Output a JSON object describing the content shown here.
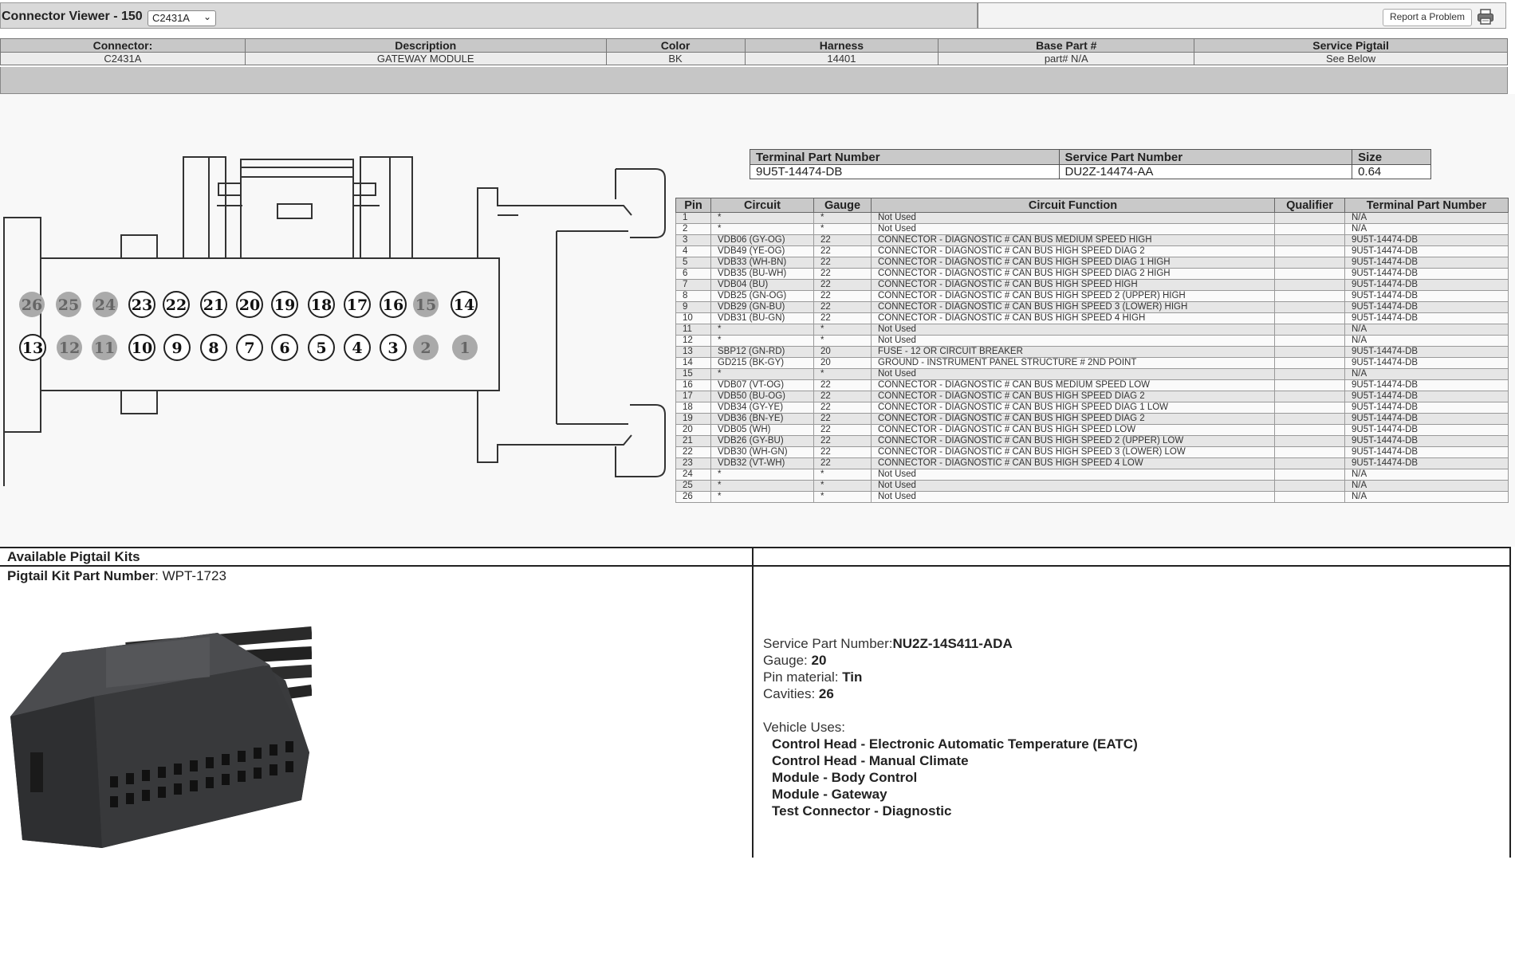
{
  "app": {
    "title": "Connector Viewer - 150",
    "selected_connector": "C2431A",
    "report_button": "Report a Problem"
  },
  "connector_header": {
    "columns": [
      "Connector:",
      "Description",
      "Color",
      "Harness",
      "Base Part #",
      "Service Pigtail"
    ],
    "values": [
      "C2431A",
      "GATEWAY MODULE",
      "BK",
      "14401",
      "part# N/A",
      "See Below"
    ]
  },
  "diagram": {
    "top_row": [
      "26",
      "25",
      "24",
      "23",
      "22",
      "21",
      "20",
      "19",
      "18",
      "17",
      "16",
      "15",
      "14"
    ],
    "bottom_row": [
      "13",
      "12",
      "11",
      "10",
      "9",
      "8",
      "7",
      "6",
      "5",
      "4",
      "3",
      "2",
      "1"
    ],
    "unused_pins": [
      "26",
      "25",
      "24",
      "15",
      "12",
      "11",
      "2",
      "1"
    ]
  },
  "terminal": {
    "headers": [
      "Terminal Part Number",
      "Service Part Number",
      "Size"
    ],
    "values": [
      "9U5T-14474-DB",
      "DU2Z-14474-AA",
      "0.64"
    ]
  },
  "pins": {
    "headers": [
      "Pin",
      "Circuit",
      "Gauge",
      "Circuit Function",
      "Qualifier",
      "Terminal Part Number"
    ],
    "rows": [
      [
        "1",
        "*",
        "*",
        "Not Used",
        "",
        "N/A"
      ],
      [
        "2",
        "*",
        "*",
        "Not Used",
        "",
        "N/A"
      ],
      [
        "3",
        "VDB06 (GY-OG)",
        "22",
        "CONNECTOR - DIAGNOSTIC # CAN BUS MEDIUM SPEED HIGH",
        "",
        "9U5T-14474-DB"
      ],
      [
        "4",
        "VDB49 (YE-OG)",
        "22",
        "CONNECTOR - DIAGNOSTIC # CAN BUS HIGH SPEED DIAG 2",
        "",
        "9U5T-14474-DB"
      ],
      [
        "5",
        "VDB33 (WH-BN)",
        "22",
        "CONNECTOR - DIAGNOSTIC # CAN BUS HIGH SPEED DIAG 1 HIGH",
        "",
        "9U5T-14474-DB"
      ],
      [
        "6",
        "VDB35 (BU-WH)",
        "22",
        "CONNECTOR - DIAGNOSTIC # CAN BUS HIGH SPEED DIAG 2 HIGH",
        "",
        "9U5T-14474-DB"
      ],
      [
        "7",
        "VDB04 (BU)",
        "22",
        "CONNECTOR - DIAGNOSTIC # CAN BUS HIGH SPEED HIGH",
        "",
        "9U5T-14474-DB"
      ],
      [
        "8",
        "VDB25 (GN-OG)",
        "22",
        "CONNECTOR - DIAGNOSTIC # CAN BUS HIGH SPEED 2 (UPPER) HIGH",
        "",
        "9U5T-14474-DB"
      ],
      [
        "9",
        "VDB29 (GN-BU)",
        "22",
        "CONNECTOR - DIAGNOSTIC # CAN BUS HIGH SPEED 3 (LOWER) HIGH",
        "",
        "9U5T-14474-DB"
      ],
      [
        "10",
        "VDB31 (BU-GN)",
        "22",
        "CONNECTOR - DIAGNOSTIC # CAN BUS HIGH SPEED 4 HIGH",
        "",
        "9U5T-14474-DB"
      ],
      [
        "11",
        "*",
        "*",
        "Not Used",
        "",
        "N/A"
      ],
      [
        "12",
        "*",
        "*",
        "Not Used",
        "",
        "N/A"
      ],
      [
        "13",
        "SBP12 (GN-RD)",
        "20",
        "FUSE - 12 OR CIRCUIT BREAKER",
        "",
        "9U5T-14474-DB"
      ],
      [
        "14",
        "GD215 (BK-GY)",
        "20",
        "GROUND - INSTRUMENT PANEL STRUCTURE # 2ND POINT",
        "",
        "9U5T-14474-DB"
      ],
      [
        "15",
        "*",
        "*",
        "Not Used",
        "",
        "N/A"
      ],
      [
        "16",
        "VDB07 (VT-OG)",
        "22",
        "CONNECTOR - DIAGNOSTIC # CAN BUS MEDIUM SPEED LOW",
        "",
        "9U5T-14474-DB"
      ],
      [
        "17",
        "VDB50 (BU-OG)",
        "22",
        "CONNECTOR - DIAGNOSTIC # CAN BUS HIGH SPEED DIAG 2",
        "",
        "9U5T-14474-DB"
      ],
      [
        "18",
        "VDB34 (GY-YE)",
        "22",
        "CONNECTOR - DIAGNOSTIC # CAN BUS HIGH SPEED DIAG 1 LOW",
        "",
        "9U5T-14474-DB"
      ],
      [
        "19",
        "VDB36 (BN-YE)",
        "22",
        "CONNECTOR - DIAGNOSTIC # CAN BUS HIGH SPEED DIAG 2",
        "",
        "9U5T-14474-DB"
      ],
      [
        "20",
        "VDB05 (WH)",
        "22",
        "CONNECTOR - DIAGNOSTIC # CAN BUS HIGH SPEED LOW",
        "",
        "9U5T-14474-DB"
      ],
      [
        "21",
        "VDB26 (GY-BU)",
        "22",
        "CONNECTOR - DIAGNOSTIC # CAN BUS HIGH SPEED 2 (UPPER) LOW",
        "",
        "9U5T-14474-DB"
      ],
      [
        "22",
        "VDB30 (WH-GN)",
        "22",
        "CONNECTOR - DIAGNOSTIC # CAN BUS HIGH SPEED 3 (LOWER) LOW",
        "",
        "9U5T-14474-DB"
      ],
      [
        "23",
        "VDB32 (VT-WH)",
        "22",
        "CONNECTOR - DIAGNOSTIC # CAN BUS HIGH SPEED 4 LOW",
        "",
        "9U5T-14474-DB"
      ],
      [
        "24",
        "*",
        "*",
        "Not Used",
        "",
        "N/A"
      ],
      [
        "25",
        "*",
        "*",
        "Not Used",
        "",
        "N/A"
      ],
      [
        "26",
        "*",
        "*",
        "Not Used",
        "",
        "N/A"
      ]
    ]
  },
  "pigtail": {
    "section_title": "Available Pigtail Kits",
    "kit_label": "Pigtail Kit Part Number",
    "kit_value": "WPT-1723",
    "service_part_label": "Service Part Number:",
    "service_part_value": "NU2Z-14S411-ADA",
    "gauge_label": "Gauge:",
    "gauge_value": "20",
    "pin_material_label": "Pin material:",
    "pin_material_value": "Tin",
    "cavities_label": "Cavities:",
    "cavities_value": "26",
    "vehicle_uses_label": "Vehicle Uses:",
    "vehicle_uses": [
      "Control Head - Electronic Automatic Temperature (EATC)",
      "Control Head - Manual Climate",
      "Module - Body Control",
      "Module - Gateway",
      "Test Connector - Diagnostic"
    ]
  }
}
